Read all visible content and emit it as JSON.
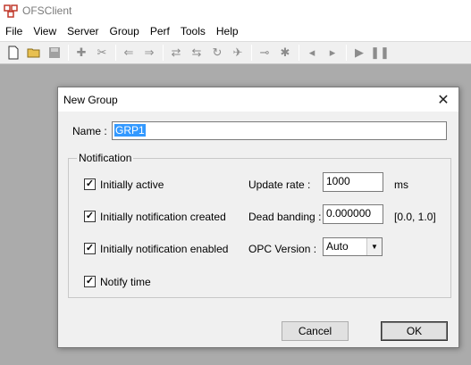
{
  "app": {
    "title": "OFSClient",
    "menu": [
      "File",
      "View",
      "Server",
      "Group",
      "Perf",
      "Tools",
      "Help"
    ]
  },
  "toolbar": {
    "buttons": [
      {
        "icon": "new-document-icon"
      },
      {
        "icon": "open-folder-icon"
      },
      {
        "icon": "save-icon"
      },
      {
        "icon": "connect-icon"
      },
      {
        "icon": "disconnect-icon"
      },
      {
        "icon": "arrow-left-icon"
      },
      {
        "icon": "arrow-right-icon"
      },
      {
        "icon": "swap-icon"
      },
      {
        "icon": "swap-alt-icon"
      },
      {
        "icon": "refresh-icon"
      },
      {
        "icon": "tool-icon"
      },
      {
        "icon": "link-icon"
      },
      {
        "icon": "gear-icon"
      },
      {
        "icon": "back-icon"
      },
      {
        "icon": "forward-icon"
      },
      {
        "icon": "play-icon"
      },
      {
        "icon": "pause-icon"
      }
    ]
  },
  "dialog": {
    "title": "New Group",
    "name_label": "Name :",
    "name_value": "GRP1",
    "group_title": "Notification",
    "checkboxes": [
      {
        "label": "Initially active",
        "checked": true
      },
      {
        "label": "Initially notification created",
        "checked": true
      },
      {
        "label": "Initially notification enabled",
        "checked": true
      },
      {
        "label": "Notify time",
        "checked": true
      }
    ],
    "update_rate": {
      "label": "Update rate :",
      "value": "1000",
      "unit": "ms"
    },
    "dead_banding": {
      "label": "Dead banding :",
      "value": "0.000000",
      "range": "[0.0, 1.0]"
    },
    "opc_version": {
      "label": "OPC Version :",
      "value": "Auto"
    },
    "cancel_label": "Cancel",
    "ok_label": "OK"
  }
}
